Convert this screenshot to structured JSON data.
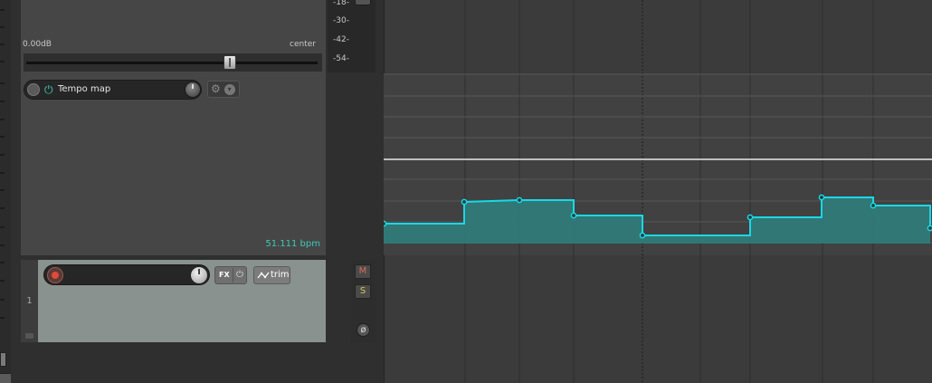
{
  "tempo_track": {
    "volume": "0.00dB",
    "pan": "center",
    "fader_level": 0.7,
    "envelope_name": "Tempo map",
    "bpm_readout": "51.111 bpm"
  },
  "meter": {
    "labels": [
      "-18-",
      "-30-",
      "-42-",
      "-54-"
    ]
  },
  "track": {
    "number": "1",
    "fx_label": "FX",
    "trim_label": "trim",
    "mute_label": "M",
    "solo_label": "S"
  },
  "colors": {
    "accent": "#3fc9b8",
    "envelope_line": "#19d8e6",
    "envelope_fill": "#2f7a78"
  },
  "icons": {
    "power": "⏻",
    "gear": "⚙",
    "down": "▾",
    "phase": "ø"
  }
}
